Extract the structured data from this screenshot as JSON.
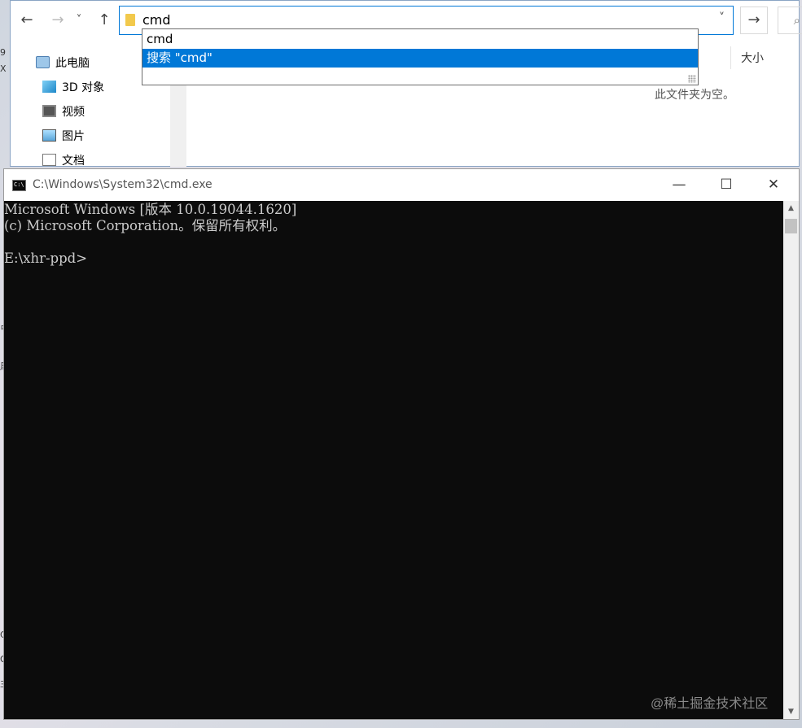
{
  "explorer": {
    "address_value": "cmd",
    "nav": {
      "back": "←",
      "forward": "→",
      "recent": "˅",
      "up": "↑",
      "go": "→",
      "dropdown": "˅",
      "search": "⌕"
    },
    "sidebar": [
      {
        "label": "此电脑",
        "icon": "computer-icon"
      },
      {
        "label": "3D 对象",
        "icon": "3d-objects-icon"
      },
      {
        "label": "视频",
        "icon": "video-icon"
      },
      {
        "label": "图片",
        "icon": "pictures-icon"
      },
      {
        "label": "文档",
        "icon": "documents-icon"
      }
    ],
    "column_size": "大小",
    "empty_message": "此文件夹为空。",
    "autocomplete": [
      {
        "label": "cmd",
        "selected": false
      },
      {
        "label": "搜索 \"cmd\"",
        "selected": true
      }
    ]
  },
  "cmd": {
    "title": "C:\\Windows\\System32\\cmd.exe",
    "icon_text": "C:\\",
    "controls": {
      "minimize": "—",
      "maximize": "☐",
      "close": "✕"
    },
    "lines": [
      "Microsoft Windows [版本 10.0.19044.1620]",
      "(c) Microsoft Corporation。保留所有权利。",
      "",
      "E:\\xhr-ppd>"
    ],
    "scroll_up": "▲",
    "scroll_down": "▼"
  },
  "watermark": "@稀土掘金技术社区",
  "edge_fragments": [
    "9",
    "X",
    "占",
    "周",
    "C",
    "O",
    "主"
  ],
  "colors": {
    "accent": "#0078d7",
    "console_bg": "#0c0c0c",
    "console_fg": "#cccccc"
  }
}
